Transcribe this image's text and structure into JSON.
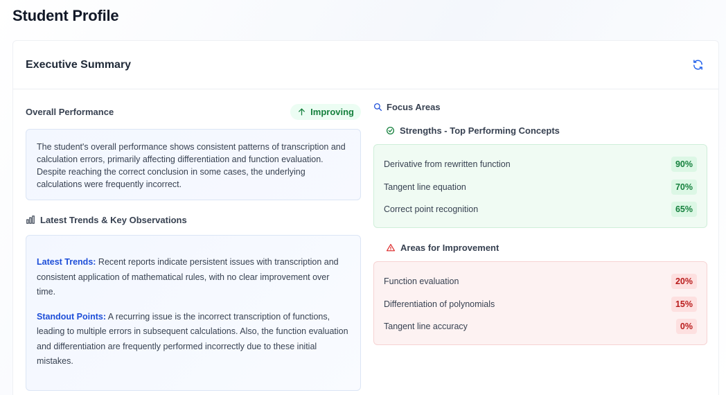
{
  "page": {
    "title": "Student Profile"
  },
  "summary_card": {
    "title": "Executive Summary",
    "refresh_icon": "refresh-icon"
  },
  "overall": {
    "label": "Overall Performance",
    "status": "Improving",
    "status_color": "#15803d",
    "text": "The student's overall performance shows consistent patterns of transcription and calculation errors, primarily affecting differentiation and function evaluation. Despite reaching the correct conclusion in some cases, the underlying calculations were frequently incorrect."
  },
  "trends": {
    "label": "Latest Trends & Key Observations",
    "latest_key": "Latest Trends:",
    "latest_text": " Recent reports indicate persistent issues with transcription and consistent application of mathematical rules, with no clear improvement over time.",
    "standout_key": "Standout Points:",
    "standout_text": " A recurring issue is the incorrect transcription of functions, leading to multiple errors in subsequent calculations. Also, the function evaluation and differentiation are frequently performed incorrectly due to these initial mistakes."
  },
  "focus": {
    "label": "Focus Areas",
    "strengths_label": "Strengths - Top Performing Concepts",
    "strengths": [
      {
        "name": "Derivative from rewritten function",
        "value": "90%"
      },
      {
        "name": "Tangent line equation",
        "value": "70%"
      },
      {
        "name": "Correct point recognition",
        "value": "65%"
      }
    ],
    "improvement_label": "Areas for Improvement",
    "improvements": [
      {
        "name": "Function evaluation",
        "value": "20%"
      },
      {
        "name": "Differentiation of polynomials",
        "value": "15%"
      },
      {
        "name": "Tangent line accuracy",
        "value": "0%"
      }
    ]
  },
  "colors": {
    "accent": "#1d4ed8",
    "good": "#15803d",
    "bad": "#b91c1c"
  }
}
